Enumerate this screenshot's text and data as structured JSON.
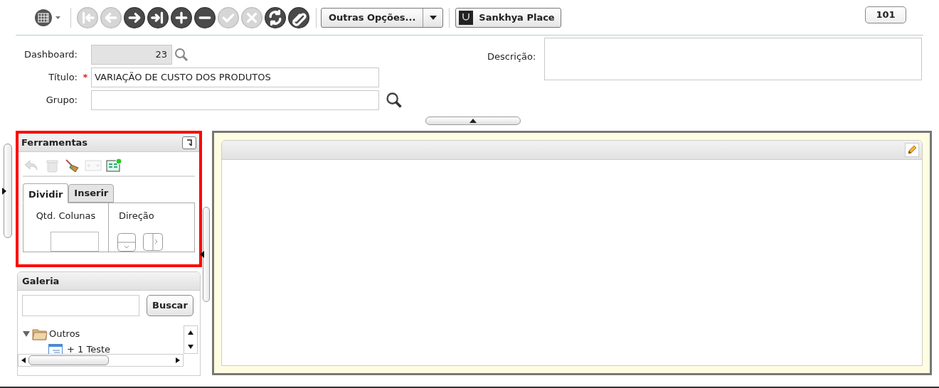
{
  "toolbar": {
    "buttons": [
      {
        "kind": "first",
        "disabled": true
      },
      {
        "kind": "previous",
        "disabled": true
      },
      {
        "kind": "next",
        "disabled": false
      },
      {
        "kind": "last",
        "disabled": false
      },
      {
        "kind": "add",
        "disabled": false
      },
      {
        "kind": "remove",
        "disabled": false
      },
      {
        "kind": "confirm",
        "disabled": true
      },
      {
        "kind": "cancel",
        "disabled": true
      },
      {
        "kind": "refresh",
        "disabled": false
      },
      {
        "kind": "attach",
        "disabled": false
      }
    ],
    "options_button": "Outras Opções...",
    "place_button": "Sankhya Place",
    "counter": "101"
  },
  "form": {
    "dashboard": {
      "label": "Dashboard:",
      "value": "23"
    },
    "title": {
      "label": "Título:",
      "value": "VARIAÇÃO DE CUSTO DOS PRODUTOS",
      "required_mark": "*"
    },
    "group": {
      "label": "Grupo:"
    },
    "description": {
      "label": "Descrição:"
    }
  },
  "tools_panel": {
    "title": "Ferramentas",
    "highlighted": true,
    "tools": [
      {
        "kind": "undo",
        "disabled": true
      },
      {
        "kind": "delete",
        "disabled": true
      },
      {
        "kind": "clean",
        "disabled": false
      },
      {
        "kind": "resize",
        "disabled": true
      },
      {
        "kind": "add_widget",
        "disabled": false
      }
    ],
    "tabs": [
      {
        "label": "Dividir",
        "selected": true
      },
      {
        "label": "Inserir",
        "selected": false
      }
    ],
    "columns_label": "Qtd. Colunas",
    "direction_label": "Direção"
  },
  "gallery": {
    "title": "Galeria",
    "search_button": "Buscar",
    "tree": [
      {
        "label": "Outros",
        "expanded": true,
        "children": [
          {
            "label": "+ 1 Teste"
          }
        ]
      }
    ]
  }
}
